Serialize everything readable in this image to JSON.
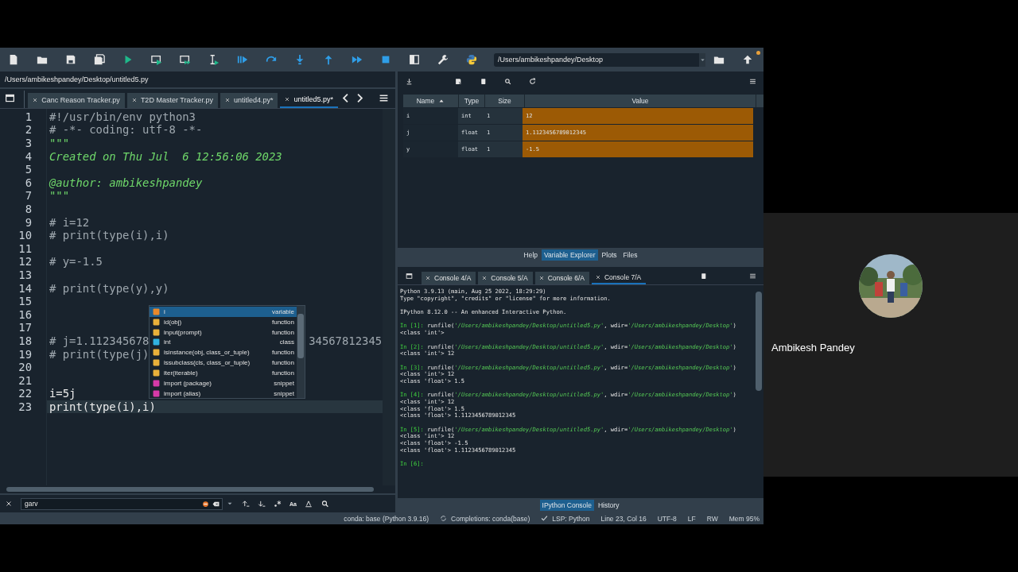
{
  "toolbar": {
    "working_directory": "/Users/ambikeshpandey/Desktop"
  },
  "editor": {
    "file_path": "/Users/ambikeshpandey/Desktop/untitled5.py",
    "tabs": [
      {
        "label": "Canc Reason Tracker.py",
        "selected": false
      },
      {
        "label": "T2D Master Tracker.py",
        "selected": false
      },
      {
        "label": "untitled4.py*",
        "selected": false
      },
      {
        "label": "untitled5.py*",
        "selected": true
      }
    ],
    "lines": [
      {
        "number": "1",
        "kind": "comment",
        "text": "#!/usr/bin/env python3",
        "current": false
      },
      {
        "number": "2",
        "kind": "comment",
        "text": "# -*- coding: utf-8 -*-",
        "current": false
      },
      {
        "number": "3",
        "kind": "docstring",
        "text": "\"\"\"",
        "current": false
      },
      {
        "number": "4",
        "kind": "docstring",
        "text": "Created on Thu Jul  6 12:56:06 2023",
        "current": false
      },
      {
        "number": "5",
        "kind": "code",
        "current": false
      },
      {
        "number": "6",
        "kind": "docstring",
        "text": "@author: ambikeshpandey",
        "current": false
      },
      {
        "number": "7",
        "kind": "docstring",
        "text": "\"\"\"",
        "current": false
      },
      {
        "number": "8",
        "kind": "code",
        "current": false
      },
      {
        "number": "9",
        "kind": "comment",
        "text": "# i=12",
        "current": false
      },
      {
        "number": "10",
        "kind": "comment",
        "text": "# print(type(i),i)",
        "current": false
      },
      {
        "number": "11",
        "kind": "code",
        "current": false
      },
      {
        "number": "12",
        "kind": "comment",
        "text": "# y=-1.5",
        "current": false
      },
      {
        "number": "13",
        "kind": "code",
        "current": false
      },
      {
        "number": "14",
        "kind": "comment",
        "text": "# print(type(y),y)",
        "current": false
      },
      {
        "number": "15",
        "kind": "code",
        "current": false
      },
      {
        "number": "16",
        "kind": "code",
        "current": false
      },
      {
        "number": "17",
        "kind": "code",
        "current": false
      },
      {
        "number": "18",
        "kind": "comment",
        "text": "# j=1.112345678",
        "tail": "34567812345",
        "current": false
      },
      {
        "number": "19",
        "kind": "comment",
        "text": "# print(type(j)",
        "current": false
      },
      {
        "number": "20",
        "kind": "code",
        "current": false
      },
      {
        "number": "21",
        "kind": "code",
        "current": false
      },
      {
        "number": "22",
        "kind": "code",
        "text": "i=5j",
        "current": false
      },
      {
        "number": "23",
        "kind": "code",
        "text": "print(type(i),i)",
        "current": true
      }
    ],
    "completion": [
      {
        "label": "i",
        "type": "variable",
        "kind": "variable",
        "selected": true
      },
      {
        "label": "id(obj)",
        "type": "function",
        "kind": "function",
        "selected": false
      },
      {
        "label": "input(prompt)",
        "type": "function",
        "kind": "function",
        "selected": false
      },
      {
        "label": "int",
        "type": "class",
        "kind": "class",
        "selected": false
      },
      {
        "label": "isinstance(obj, class_or_tuple)",
        "type": "function",
        "kind": "function",
        "selected": false
      },
      {
        "label": "issubclass(cls, class_or_tuple)",
        "type": "function",
        "kind": "function",
        "selected": false
      },
      {
        "label": "iter(iterable)",
        "type": "function",
        "kind": "function",
        "selected": false
      },
      {
        "label": "import (package)",
        "type": "snippet",
        "kind": "snippet",
        "selected": false
      },
      {
        "label": "import (alias)",
        "type": "snippet",
        "kind": "snippet",
        "selected": false
      }
    ]
  },
  "search": {
    "value": "garv",
    "case_label": "Aa"
  },
  "variable_explorer": {
    "columns": [
      {
        "label": "Name",
        "sorted": true
      },
      {
        "label": "Type",
        "sorted": false
      },
      {
        "label": "Size",
        "sorted": false
      },
      {
        "label": "Value",
        "sorted": false
      }
    ],
    "rows": [
      {
        "name": "i",
        "type": "int",
        "size": "1",
        "value": "12"
      },
      {
        "name": "j",
        "type": "float",
        "size": "1",
        "value": "1.1123456789012345"
      },
      {
        "name": "y",
        "type": "float",
        "size": "1",
        "value": "-1.5"
      }
    ]
  },
  "upper_pane_tabs": [
    {
      "label": "Help",
      "selected": false
    },
    {
      "label": "Variable Explorer",
      "selected": true
    },
    {
      "label": "Plots",
      "selected": false
    },
    {
      "label": "Files",
      "selected": false
    }
  ],
  "console": {
    "tabs": [
      {
        "label": "Console 4/A",
        "selected": false
      },
      {
        "label": "Console 5/A",
        "selected": false
      },
      {
        "label": "Console 6/A",
        "selected": false
      },
      {
        "label": "Console 7/A",
        "selected": true
      }
    ],
    "blocks": [
      {
        "lines": [
          {
            "parts": [
              {
                "text": "Python 3.9.13 (main, Aug 25 2022, 18:29:29)",
                "kind": "plain"
              }
            ]
          },
          {
            "parts": [
              {
                "text": "Type \"copyright\", \"credits\" or \"license\" for more information.",
                "kind": "plain"
              }
            ]
          }
        ]
      },
      {
        "lines": [
          {
            "parts": [
              {
                "text": "IPython 8.12.0 -- An enhanced Interactive Python.",
                "kind": "plain"
              }
            ]
          }
        ]
      },
      {
        "lines": [
          {
            "parts": [
              {
                "text": "In [1]:",
                "kind": "prompt"
              },
              {
                "text": "runfile(",
                "kind": "plain"
              },
              {
                "text": "'/Users/ambikeshpandey/Desktop/untitled5.py'",
                "kind": "string"
              },
              {
                "text": ", wdir=",
                "kind": "plain"
              },
              {
                "text": "'/Users/ambikeshpandey/Desktop'",
                "kind": "string"
              },
              {
                "text": ")",
                "kind": "plain"
              }
            ]
          },
          {
            "parts": [
              {
                "text": "<class 'int'>",
                "kind": "plain"
              }
            ]
          }
        ]
      },
      {
        "lines": [
          {
            "parts": [
              {
                "text": "In [2]:",
                "kind": "prompt"
              },
              {
                "text": "runfile(",
                "kind": "plain"
              },
              {
                "text": "'/Users/ambikeshpandey/Desktop/untitled5.py'",
                "kind": "string"
              },
              {
                "text": ", wdir=",
                "kind": "plain"
              },
              {
                "text": "'/Users/ambikeshpandey/Desktop'",
                "kind": "string"
              },
              {
                "text": ")",
                "kind": "plain"
              }
            ]
          },
          {
            "parts": [
              {
                "text": "<class 'int'> 12",
                "kind": "plain"
              }
            ]
          }
        ]
      },
      {
        "lines": [
          {
            "parts": [
              {
                "text": "In [3]:",
                "kind": "prompt"
              },
              {
                "text": "runfile(",
                "kind": "plain"
              },
              {
                "text": "'/Users/ambikeshpandey/Desktop/untitled5.py'",
                "kind": "string"
              },
              {
                "text": ", wdir=",
                "kind": "plain"
              },
              {
                "text": "'/Users/ambikeshpandey/Desktop'",
                "kind": "string"
              },
              {
                "text": ")",
                "kind": "plain"
              }
            ]
          },
          {
            "parts": [
              {
                "text": "<class 'int'> 12",
                "kind": "plain"
              }
            ]
          },
          {
            "parts": [
              {
                "text": "<class 'float'> 1.5",
                "kind": "plain"
              }
            ]
          }
        ]
      },
      {
        "lines": [
          {
            "parts": [
              {
                "text": "In [4]:",
                "kind": "prompt"
              },
              {
                "text": "runfile(",
                "kind": "plain"
              },
              {
                "text": "'/Users/ambikeshpandey/Desktop/untitled5.py'",
                "kind": "string"
              },
              {
                "text": ", wdir=",
                "kind": "plain"
              },
              {
                "text": "'/Users/ambikeshpandey/Desktop'",
                "kind": "string"
              },
              {
                "text": ")",
                "kind": "plain"
              }
            ]
          },
          {
            "parts": [
              {
                "text": "<class 'int'> 12",
                "kind": "plain"
              }
            ]
          },
          {
            "parts": [
              {
                "text": "<class 'float'> 1.5",
                "kind": "plain"
              }
            ]
          },
          {
            "parts": [
              {
                "text": "<class 'float'> 1.1123456789012345",
                "kind": "plain"
              }
            ]
          }
        ]
      },
      {
        "lines": [
          {
            "parts": [
              {
                "text": "In [5]:",
                "kind": "prompt"
              },
              {
                "text": "runfile(",
                "kind": "plain"
              },
              {
                "text": "'/Users/ambikeshpandey/Desktop/untitled5.py'",
                "kind": "string"
              },
              {
                "text": ", wdir=",
                "kind": "plain"
              },
              {
                "text": "'/Users/ambikeshpandey/Desktop'",
                "kind": "string"
              },
              {
                "text": ")",
                "kind": "plain"
              }
            ]
          },
          {
            "parts": [
              {
                "text": "<class 'int'> 12",
                "kind": "plain"
              }
            ]
          },
          {
            "parts": [
              {
                "text": "<class 'float'> -1.5",
                "kind": "plain"
              }
            ]
          },
          {
            "parts": [
              {
                "text": "<class 'float'> 1.1123456789012345",
                "kind": "plain"
              }
            ]
          }
        ]
      },
      {
        "lines": [
          {
            "parts": [
              {
                "text": "In [6]:",
                "kind": "prompt"
              }
            ]
          }
        ]
      }
    ]
  },
  "lower_pane_tabs": [
    {
      "label": "IPython Console",
      "selected": true
    },
    {
      "label": "History",
      "selected": false
    }
  ],
  "status_bar": [
    {
      "kind": "plain",
      "text": "conda: base (Python 3.9.16)"
    },
    {
      "kind": "sync",
      "text": "Completions: conda(base)"
    },
    {
      "kind": "check",
      "text": "LSP: Python"
    },
    {
      "kind": "plain",
      "text": "Line 23, Col 16"
    },
    {
      "kind": "plain",
      "text": "UTF-8"
    },
    {
      "kind": "plain",
      "text": "LF"
    },
    {
      "kind": "plain",
      "text": "RW"
    },
    {
      "kind": "plain",
      "text": "Mem 95%"
    }
  ],
  "participant": {
    "name": "Ambikesh Pandey"
  }
}
